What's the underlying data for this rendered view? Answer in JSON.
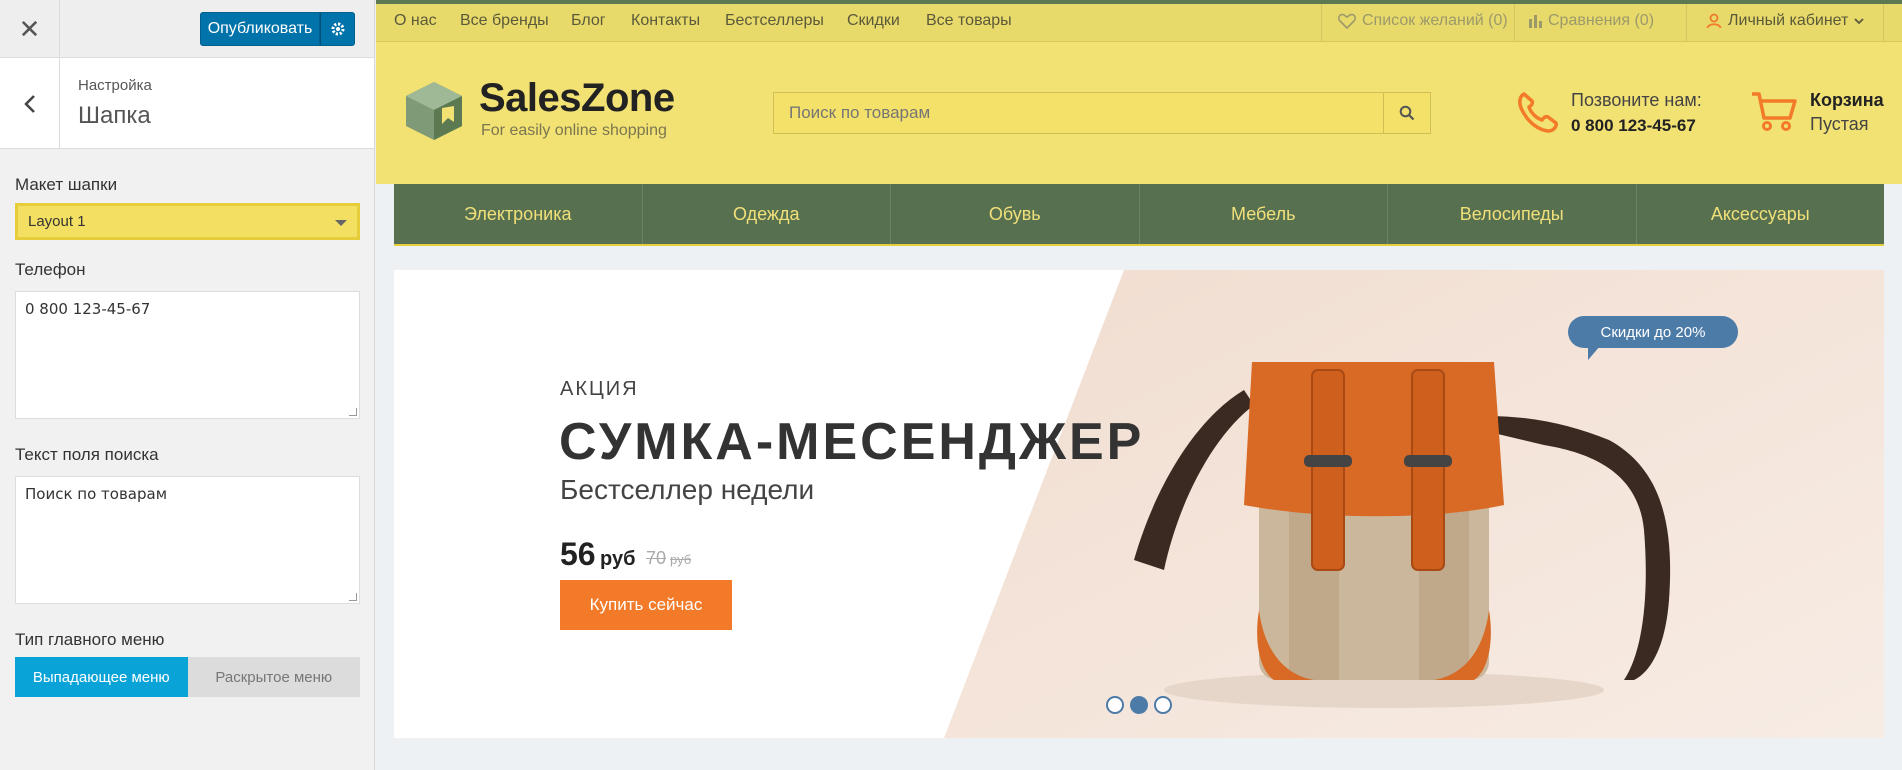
{
  "sidebar": {
    "publish_label": "Опубликовать",
    "breadcrumb": "Настройка",
    "section_title": "Шапка",
    "layout": {
      "label": "Макет шапки",
      "value": "Layout 1"
    },
    "phone": {
      "label": "Телефон",
      "value": "0 800 123-45-67"
    },
    "search_text": {
      "label": "Текст поля поиска",
      "value": "Поиск по товарам"
    },
    "menu_type": {
      "label": "Тип главного меню",
      "options": [
        "Выпадающее меню",
        "Раскрытое меню"
      ],
      "selected": "Выпадающее меню"
    }
  },
  "site": {
    "topnav": [
      "О нас",
      "Все бренды",
      "Блог",
      "Контакты",
      "Бестселлеры",
      "Скидки",
      "Все товары"
    ],
    "wishlist": "Список желаний (0)",
    "compare": "Сравнения (0)",
    "account": "Личный кабинет",
    "logo": {
      "name": "SalesZone",
      "tagline": "For easily online shopping"
    },
    "search_placeholder": "Поиск по товарам",
    "phone_label": "Позвоните нам:",
    "phone_number": "0 800 123-45-67",
    "cart_label": "Корзина",
    "cart_status": "Пустая",
    "categories": [
      "Электроника",
      "Одежда",
      "Обувь",
      "Мебель",
      "Велосипеды",
      "Аксессуары"
    ],
    "banner": {
      "kicker": "АКЦИЯ",
      "title": "СУМКА-МЕСЕНДЖЕР",
      "subtitle": "Бестселлер недели",
      "price": "56",
      "currency": "руб",
      "old_price": "70",
      "old_currency": "руб",
      "button": "Купить сейчас",
      "badge": "Скидки до 20%",
      "slides": 3,
      "active_slide": 2
    }
  },
  "colors": {
    "accent": "#0073aa",
    "header_bg": "#f2e173",
    "nav_bg": "#567050",
    "cta": "#f27a28",
    "badge": "#4d7ba8"
  }
}
